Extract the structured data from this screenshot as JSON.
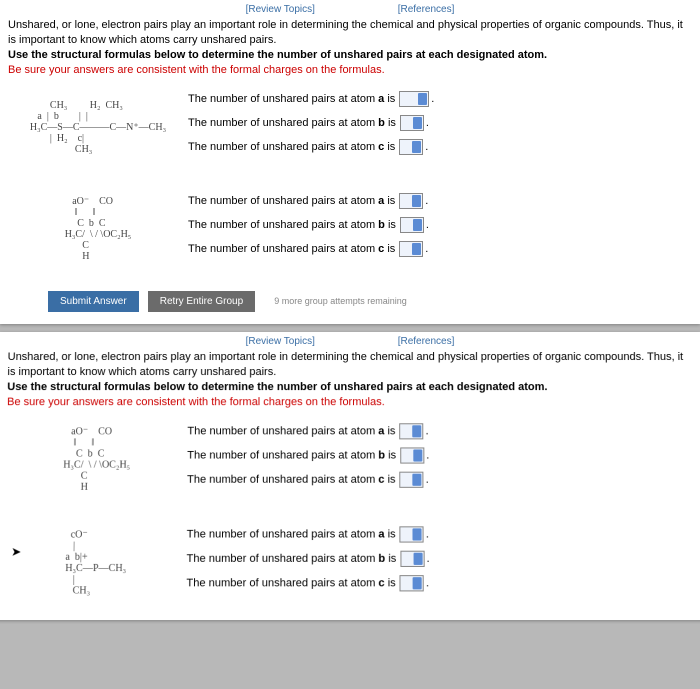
{
  "links": {
    "review": "[Review Topics]",
    "references": "[References]"
  },
  "intro": {
    "line1a": "Unshared, or lone, electron pairs play an important role in determining the chemical and physical properties of organic compounds. Thus, it is important to know which atoms carry unshared pairs.",
    "line2": "Use the structural formulas below to determine the number of unshared pairs at each designated atom.",
    "line3": "Be sure your answers are consistent with the formal charges on the formulas."
  },
  "q": {
    "a": "The number of unshared pairs at atom ",
    "alabel": "a",
    "b": "The number of unshared pairs at atom ",
    "blabel": "b",
    "c": "The number of unshared pairs at atom ",
    "clabel": "c",
    "is": " is"
  },
  "structures": {
    "s1": "        CH₃         H₂  CH₃\n   a  |  b        |  |\nH₃C—S—C———C—N⁺—CH₃\n        |  H₂    c|\n                  CH₃",
    "s2": "   aO⁻    CO\n    ‖      ‖\n     C  b  C\nH₃C/  \\ / \\OC₂H₅\n       C\n       H",
    "s3": "   aO⁻    CO\n    ‖      ‖\n     C  b  C\nH₃C/  \\ / \\OC₂H₅\n       C\n       H",
    "s4": "  cO⁻\n   |\na  b|+\nH₃C—P—CH₃\n   |\n   CH₃"
  },
  "buttons": {
    "submit": "Submit Answer",
    "retry": "Retry Entire Group",
    "attempts": "9 more group attempts remaining"
  }
}
